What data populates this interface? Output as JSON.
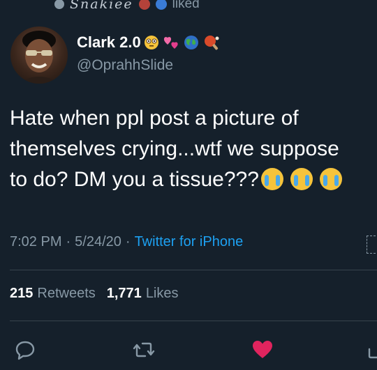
{
  "liked_bar": {
    "user_name": "Snakiee",
    "liked_label": "liked"
  },
  "tweet": {
    "author": {
      "display_name": "Clark 2.0",
      "name_emojis": [
        "flushed-face",
        "two-hearts",
        "globe",
        "ping-pong"
      ],
      "handle": "@OprahhSlide"
    },
    "text_lines": [
      "Hate when ppl post a picture of",
      "themselves crying...wtf we suppose",
      "to do? DM you a tissue???"
    ],
    "text_emojis": [
      "loudly-crying-face",
      "loudly-crying-face",
      "loudly-crying-face"
    ],
    "time": "7:02 PM",
    "date": "5/24/20",
    "separator": "·",
    "source": "Twitter for iPhone",
    "stats": {
      "retweets_count": "215",
      "retweets_label": "Retweets",
      "likes_count": "1,771",
      "likes_label": "Likes"
    },
    "liked_by_viewer": true
  },
  "colors": {
    "background": "#15202b",
    "secondary_text": "#8899a6",
    "accent_blue": "#1da1f2",
    "like_red": "#e0245e",
    "divider": "#38444d"
  }
}
